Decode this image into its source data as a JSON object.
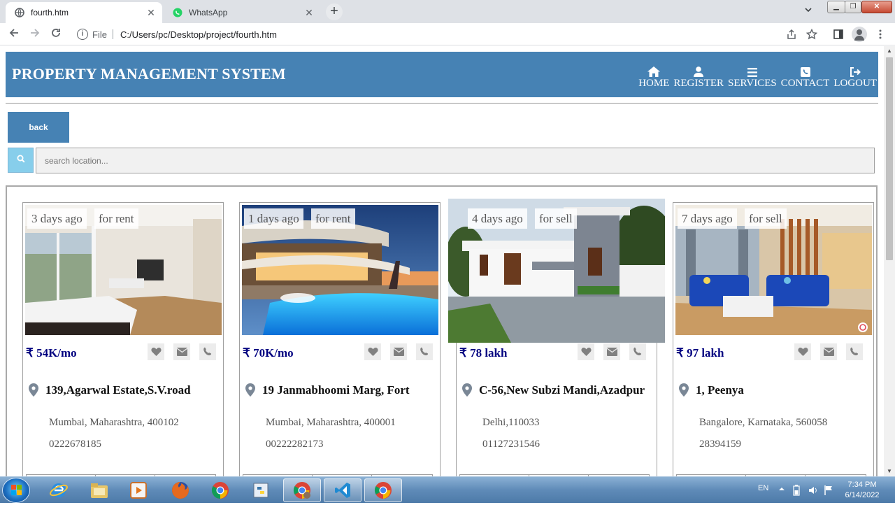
{
  "browser": {
    "tabs": [
      {
        "title": "fourth.htm",
        "close": "✕",
        "active": true
      },
      {
        "title": "WhatsApp",
        "close": "✕",
        "active": false
      }
    ],
    "new_tab": "+",
    "address": {
      "scheme": "File",
      "url": "C:/Users/pc/Desktop/project/fourth.htm"
    }
  },
  "header": {
    "title": "PROPERTY MANAGEMENT SYSTEM",
    "nav": [
      {
        "label": "HOME",
        "icon": "home-icon"
      },
      {
        "label": "REGISTER",
        "icon": "user-icon"
      },
      {
        "label": "SERVICES",
        "icon": "menu-icon"
      },
      {
        "label": "CONTACT",
        "icon": "phone-square-icon"
      },
      {
        "label": "LOGOUT",
        "icon": "logout-icon"
      }
    ]
  },
  "back_label": "back",
  "search": {
    "placeholder": "search location..."
  },
  "listings": [
    {
      "age": "3 days ago",
      "type": "for rent",
      "price": "₹ 54K/mo",
      "address": "139,Agarwal Estate,S.V.road",
      "city": "Mumbai, Maharashtra, 400102",
      "phone": "0222678185"
    },
    {
      "age": "1 days ago",
      "type": "for rent",
      "price": "₹ 70K/mo",
      "address": "19 Janmabhoomi Marg, Fort",
      "city": "Mumbai, Maharashtra, 400001",
      "phone": "00222282173"
    },
    {
      "age": "4 days ago",
      "type": "for sell",
      "price": "₹ 78 lakh",
      "address": "C-56,New Subzi Mandi,Azadpur",
      "city": "Delhi,110033",
      "phone": "01127231546"
    },
    {
      "age": "7 days ago",
      "type": "for sell",
      "price": "₹ 97 lakh",
      "address": "1, Peenya",
      "city": "Bangalore, Karnataka, 560058",
      "phone": "28394159"
    }
  ],
  "taskbar": {
    "language": "EN",
    "time": "7:34 PM",
    "date": "6/14/2022"
  },
  "colors": {
    "header": "#4682b4",
    "price": "#000080",
    "search_button": "#87ceeb"
  }
}
